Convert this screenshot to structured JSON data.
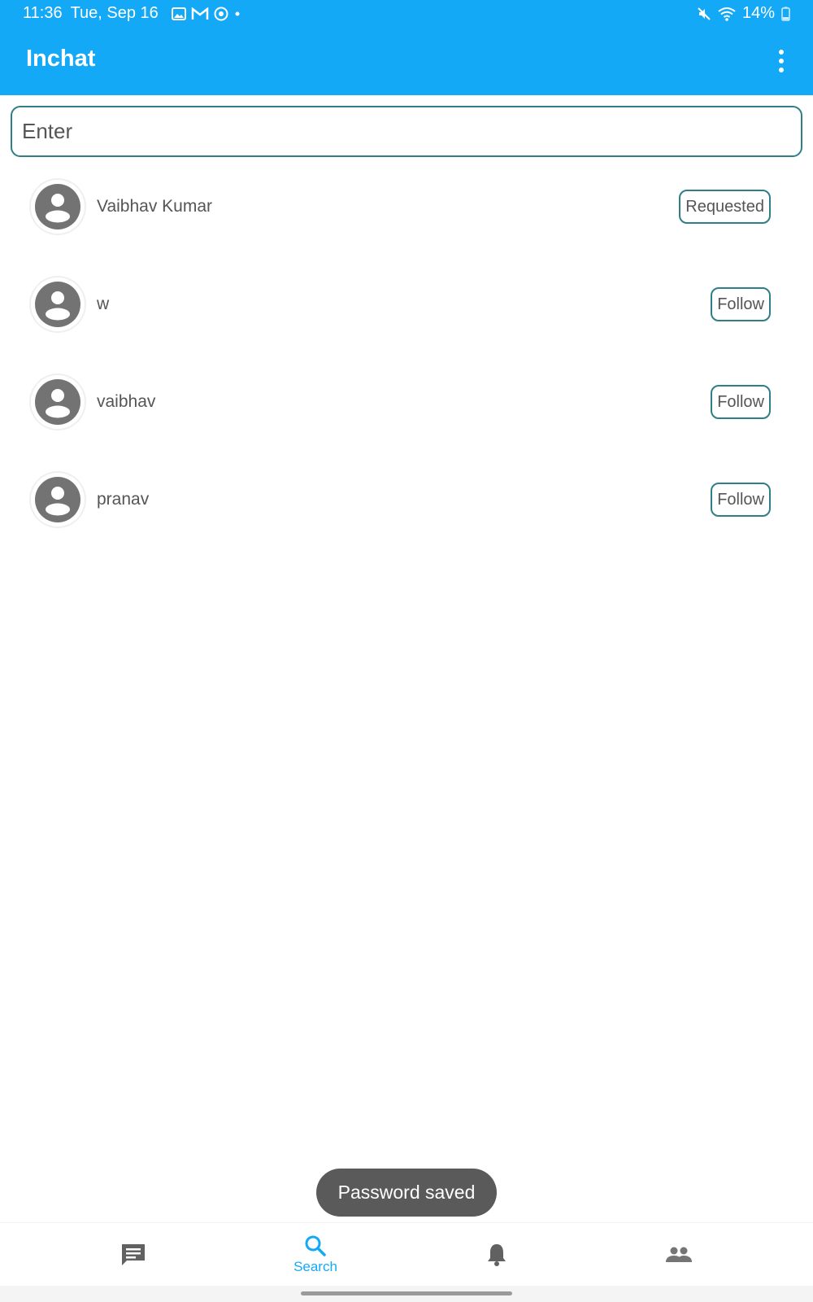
{
  "status_bar": {
    "time": "11:36",
    "date": "Tue, Sep 16",
    "battery": "14%"
  },
  "app": {
    "title": "Inchat"
  },
  "search": {
    "placeholder": "Enter"
  },
  "users": [
    {
      "name": "Vaibhav Kumar",
      "action": "Requested"
    },
    {
      "name": "w",
      "action": "Follow"
    },
    {
      "name": "vaibhav",
      "action": "Follow"
    },
    {
      "name": "pranav",
      "action": "Follow"
    }
  ],
  "toast": {
    "text": "Password saved"
  },
  "bottom_nav": {
    "items": [
      {
        "icon": "chat-icon"
      },
      {
        "icon": "search-icon",
        "label": "Search",
        "active": true
      },
      {
        "icon": "bell-icon"
      },
      {
        "icon": "people-icon"
      }
    ]
  },
  "colors": {
    "primary": "#13a9f6",
    "outline": "#2e7f86"
  }
}
